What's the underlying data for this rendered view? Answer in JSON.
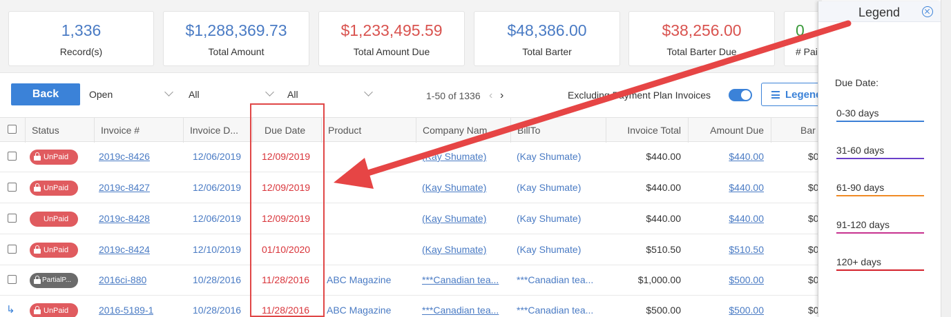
{
  "stats": [
    {
      "value": "1,336",
      "label": "Record(s)",
      "color": "#4a7bc4"
    },
    {
      "value": "$1,288,369.73",
      "label": "Total Amount",
      "color": "#4a7bc4"
    },
    {
      "value": "$1,233,495.59",
      "label": "Total Amount Due",
      "color": "#d9534f"
    },
    {
      "value": "$48,386.00",
      "label": "Total Barter",
      "color": "#4a7bc4"
    },
    {
      "value": "$38,256.00",
      "label": "Total Barter Due",
      "color": "#d9534f"
    },
    {
      "value": "0",
      "label": "# Paid",
      "color": "#3a9a3a"
    }
  ],
  "toolbar": {
    "back_label": "Back",
    "filter_status": "Open",
    "filter_two": "All",
    "filter_three": "All",
    "pager_text": "1-50 of 1336",
    "prev_icon": "‹",
    "next_icon": "›",
    "excluding_label": "Excluding Payment Plan Invoices",
    "legend_label": "Legend"
  },
  "table": {
    "columns": [
      "Status",
      "Invoice #",
      "Invoice D...",
      "Due Date",
      "Product",
      "Company Nam",
      "BillTo",
      "Invoice Total",
      "Amount Due",
      "Bar"
    ],
    "rows": [
      {
        "status": "UnPaid",
        "locked": true,
        "invoice": "2019c-8426",
        "invoice_date": "12/06/2019",
        "due_date": "12/09/2019",
        "product": "",
        "company": "(Kay Shumate)",
        "billto": "(Kay Shumate)",
        "total": "$440.00",
        "amount_due": "$440.00",
        "barter": "$0",
        "child": false
      },
      {
        "status": "UnPaid",
        "locked": true,
        "invoice": "2019c-8427",
        "invoice_date": "12/06/2019",
        "due_date": "12/09/2019",
        "product": "",
        "company": "(Kay Shumate)",
        "billto": "(Kay Shumate)",
        "total": "$440.00",
        "amount_due": "$440.00",
        "barter": "$0",
        "child": false
      },
      {
        "status": "UnPaid",
        "locked": false,
        "invoice": "2019c-8428",
        "invoice_date": "12/06/2019",
        "due_date": "12/09/2019",
        "product": "",
        "company": "(Kay Shumate)",
        "billto": "(Kay Shumate)",
        "total": "$440.00",
        "amount_due": "$440.00",
        "barter": "$0",
        "child": false
      },
      {
        "status": "UnPaid",
        "locked": true,
        "invoice": "2019c-8424",
        "invoice_date": "12/10/2019",
        "due_date": "01/10/2020",
        "product": "",
        "company": "(Kay Shumate)",
        "billto": "(Kay Shumate)",
        "total": "$510.50",
        "amount_due": "$510.50",
        "barter": "$0",
        "child": false
      },
      {
        "status": "PartialP...",
        "locked": true,
        "invoice": "2016ci-880",
        "invoice_date": "10/28/2016",
        "due_date": "11/28/2016",
        "product": "ABC Magazine",
        "company": "***Canadian tea...",
        "billto": "***Canadian tea...",
        "total": "$1,000.00",
        "amount_due": "$500.00",
        "barter": "$0",
        "child": false
      },
      {
        "status": "UnPaid",
        "locked": true,
        "invoice": "2016-5189-1",
        "invoice_date": "10/28/2016",
        "due_date": "11/28/2016",
        "product": "ABC Magazine",
        "company": "***Canadian tea...",
        "billto": "***Canadian tea...",
        "total": "$500.00",
        "amount_due": "$500.00",
        "barter": "$0",
        "child": true
      }
    ]
  },
  "legend": {
    "title": "Legend",
    "due_date_label": "Due Date:",
    "items": [
      {
        "label": "0-30 days",
        "color": "#3b7fd6"
      },
      {
        "label": "31-60 days",
        "color": "#6a3fc9"
      },
      {
        "label": "61-90 days",
        "color": "#f08a24"
      },
      {
        "label": "91-120 days",
        "color": "#c7318f"
      },
      {
        "label": "120+ days",
        "color": "#d4202a"
      }
    ]
  },
  "annotation": {
    "color": "#e04646"
  }
}
